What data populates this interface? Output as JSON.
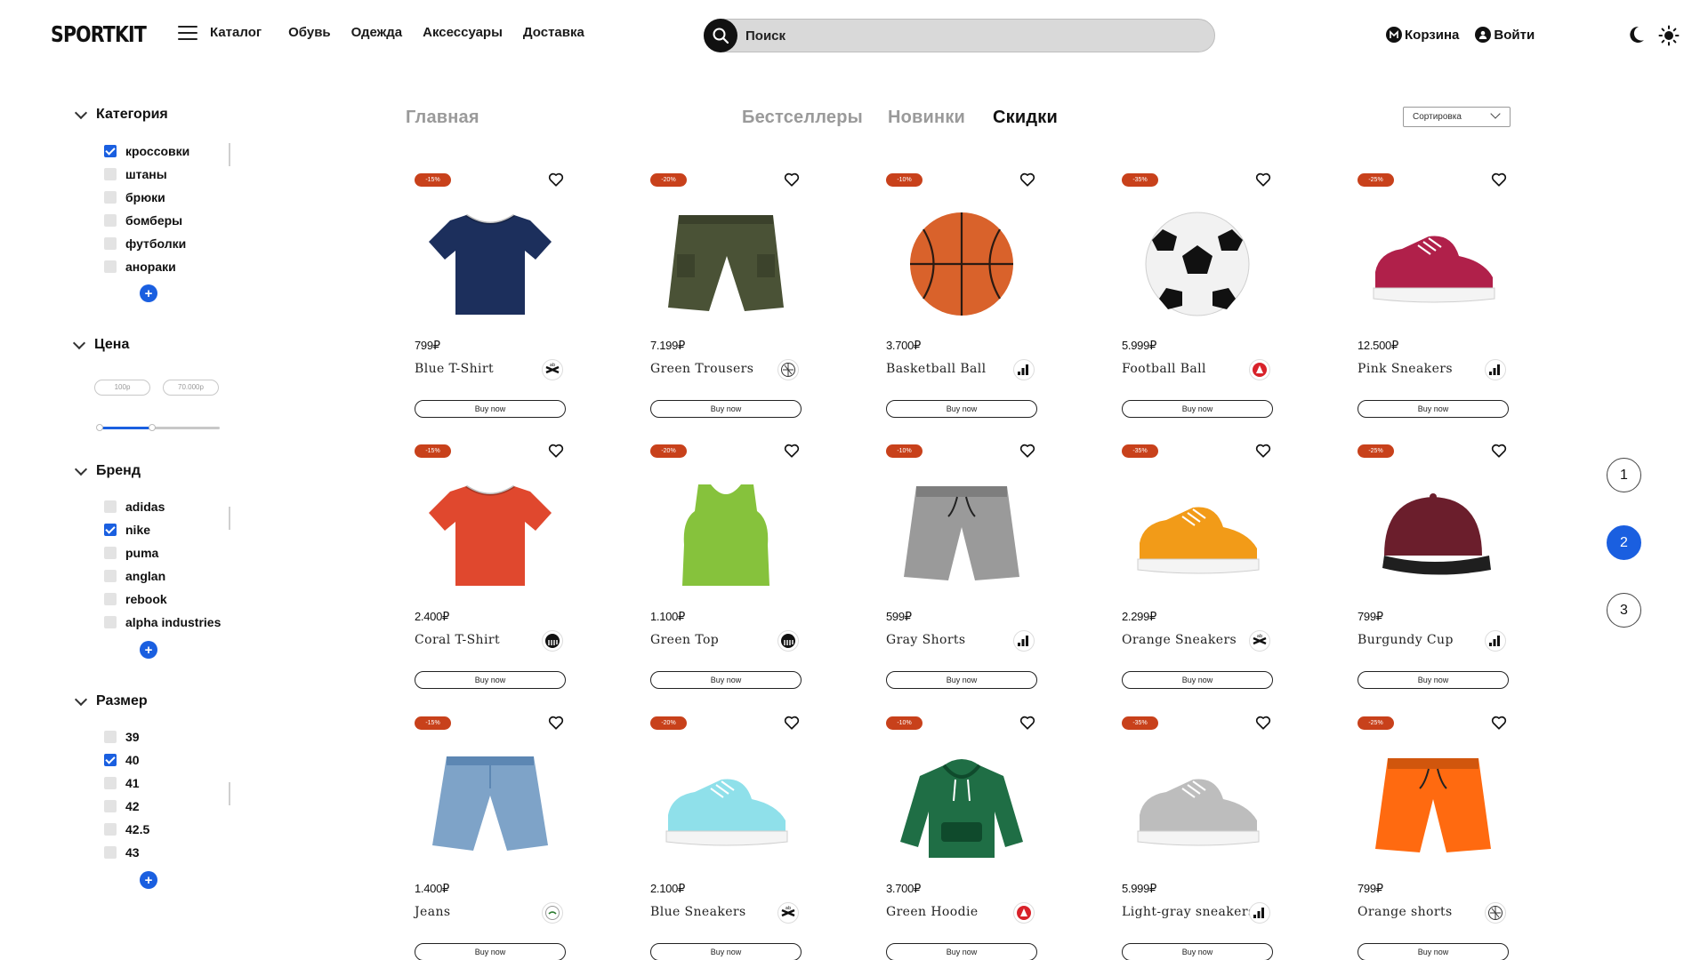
{
  "header": {
    "logo": "SPORTKIT",
    "nav": [
      "Каталог",
      "Обувь",
      "Одежда",
      "Аксессуары",
      "Доставка"
    ],
    "search_placeholder": "Поиск",
    "cart_label": "Корзина",
    "login_label": "Войти"
  },
  "sidebar": {
    "category": {
      "title": "Категория",
      "options": [
        {
          "label": "кроссовки",
          "checked": true
        },
        {
          "label": "штаны",
          "checked": false
        },
        {
          "label": "брюки",
          "checked": false
        },
        {
          "label": "бомберы",
          "checked": false
        },
        {
          "label": "футболки",
          "checked": false
        },
        {
          "label": "анораки",
          "checked": false
        }
      ]
    },
    "price": {
      "title": "Цена",
      "min_placeholder": "100р",
      "max_placeholder": "70.000р",
      "range_fraction": [
        0.0,
        0.36
      ]
    },
    "brand": {
      "title": "Бренд",
      "options": [
        {
          "label": "adidas",
          "checked": false
        },
        {
          "label": "nike",
          "checked": true
        },
        {
          "label": "puma",
          "checked": false
        },
        {
          "label": "anglan",
          "checked": false
        },
        {
          "label": "rebook",
          "checked": false
        },
        {
          "label": "alpha industries",
          "checked": false
        }
      ]
    },
    "size": {
      "title": "Размер",
      "options": [
        {
          "label": "39",
          "checked": false
        },
        {
          "label": "40",
          "checked": true
        },
        {
          "label": "41",
          "checked": false
        },
        {
          "label": "42",
          "checked": false
        },
        {
          "label": "42.5",
          "checked": false
        },
        {
          "label": "43",
          "checked": false
        }
      ]
    },
    "more_label": "+"
  },
  "tabs": {
    "home": "Главная",
    "bestsellers": "Бестселлеры",
    "new": "Новинки",
    "sale": "Скидки",
    "active": "sale"
  },
  "sort_label": "Сортировка",
  "buy_label": "Buy now",
  "colors": {
    "accent": "#1a5fe0",
    "badge": "#c8411b"
  },
  "products": [
    {
      "badge": "-15%",
      "price": "799₽",
      "name": "Blue T-Shirt",
      "brand_icon": "reebok-logo-icon",
      "image": "tshirt",
      "color": "#1c2f5c"
    },
    {
      "badge": "-20%",
      "price": "7.199₽",
      "name": "Green Trousers",
      "brand_icon": "anglan-logo-icon",
      "image": "trousers",
      "color": "#4a5236"
    },
    {
      "badge": "-10%",
      "price": "3.700₽",
      "name": "Basketball Ball",
      "brand_icon": "adidas-logo-icon",
      "image": "basketball",
      "color": "#d9622b"
    },
    {
      "badge": "-35%",
      "price": "5.999₽",
      "name": "Football Ball",
      "brand_icon": "alpha-logo-icon",
      "image": "football",
      "color": "#f2f2f2"
    },
    {
      "badge": "-25%",
      "price": "12.500₽",
      "name": "Pink Sneakers",
      "brand_icon": "adidas-logo-icon",
      "image": "sneaker",
      "color": "#b0204a"
    },
    {
      "badge": "-15%",
      "price": "2.400₽",
      "name": "Coral T-Shirt",
      "brand_icon": "puma-logo-icon",
      "image": "tshirt",
      "color": "#e0482e"
    },
    {
      "badge": "-20%",
      "price": "1.100₽",
      "name": "Green Top",
      "brand_icon": "puma-logo-icon",
      "image": "tanktop",
      "color": "#86c23c"
    },
    {
      "badge": "-10%",
      "price": "599₽",
      "name": "Gray Shorts",
      "brand_icon": "adidas-logo-icon",
      "image": "shorts",
      "color": "#9a9a9a"
    },
    {
      "badge": "-35%",
      "price": "2.299₽",
      "name": "Orange Sneakers",
      "brand_icon": "reebok-logo-icon",
      "image": "sneaker",
      "color": "#f29b18"
    },
    {
      "badge": "-25%",
      "price": "799₽",
      "name": "Burgundy Cup",
      "brand_icon": "adidas-logo-icon",
      "image": "cap",
      "color": "#6b1e2c"
    },
    {
      "badge": "-15%",
      "price": "1.400₽",
      "name": "Jeans",
      "brand_icon": "lacoste-logo-icon",
      "image": "jeans",
      "color": "#7ea3c8"
    },
    {
      "badge": "-20%",
      "price": "2.100₽",
      "name": "Blue Sneakers",
      "brand_icon": "reebok-logo-icon",
      "image": "sneaker",
      "color": "#8fe0ea"
    },
    {
      "badge": "-10%",
      "price": "3.700₽",
      "name": "Green Hoodie",
      "brand_icon": "alpha-logo-icon",
      "image": "hoodie",
      "color": "#1f6e45"
    },
    {
      "badge": "-35%",
      "price": "5.999₽",
      "name": "Light-gray sneakers",
      "brand_icon": "adidas-logo-icon",
      "image": "sneaker",
      "color": "#bdbdbd"
    },
    {
      "badge": "-25%",
      "price": "799₽",
      "name": "Orange shorts",
      "brand_icon": "anglan-logo-icon",
      "image": "shorts",
      "color": "#ff6a10"
    }
  ],
  "pagination": {
    "pages": [
      "1",
      "2",
      "3"
    ],
    "current": "2"
  }
}
